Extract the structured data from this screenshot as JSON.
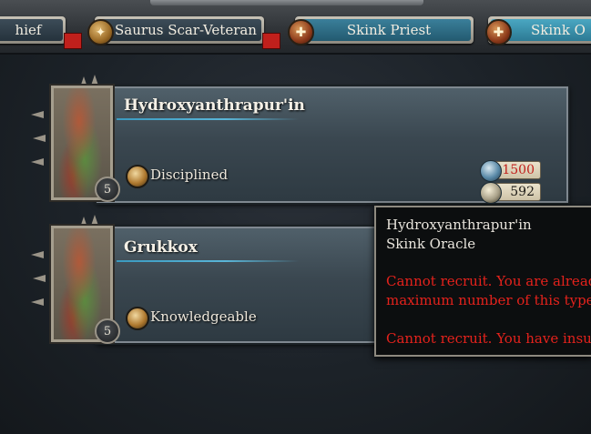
{
  "tabs": [
    {
      "label": "hief"
    },
    {
      "label": "Saurus Scar-Veteran"
    },
    {
      "label": "Skink Priest"
    },
    {
      "label": "Skink O"
    }
  ],
  "characters": [
    {
      "name": "Hydroxyanthrapur'in",
      "trait": "Disciplined",
      "rank": "5",
      "recruit_cost": "1500",
      "upkeep": "592"
    },
    {
      "name": "Grukkox",
      "trait": "Knowledgeable",
      "rank": "5"
    }
  ],
  "tooltip": {
    "name": "Hydroxyanthrapur'in",
    "type": "Skink Oracle",
    "error_line1": "Cannot recruit. You are alread",
    "error_line2": "maximum number of this type",
    "error_line3": "Cannot recruit. You have insu"
  },
  "colors": {
    "error_text": "#e4221c",
    "cost_unaffordable": "#c0201c",
    "tab_active": "#4aa7c2"
  }
}
